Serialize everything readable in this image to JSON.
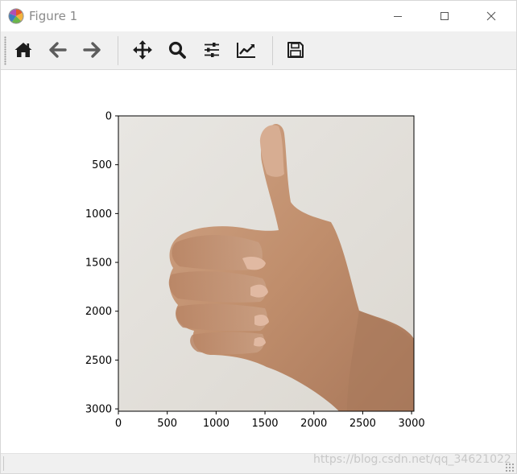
{
  "window": {
    "title": "Figure 1",
    "controls": [
      "minimize",
      "maximize",
      "close"
    ]
  },
  "toolbar": {
    "buttons": [
      {
        "name": "home",
        "icon": "home-icon",
        "tooltip": "Reset original view"
      },
      {
        "name": "back",
        "icon": "arrow-left-icon",
        "tooltip": "Back to previous view"
      },
      {
        "name": "forward",
        "icon": "arrow-right-icon",
        "tooltip": "Forward to next view"
      },
      {
        "name": "pan",
        "icon": "move-icon",
        "tooltip": "Pan axes"
      },
      {
        "name": "zoom",
        "icon": "search-icon",
        "tooltip": "Zoom to rectangle"
      },
      {
        "name": "subplots",
        "icon": "sliders-icon",
        "tooltip": "Configure subplots"
      },
      {
        "name": "customize",
        "icon": "chart-line-icon",
        "tooltip": "Edit axis"
      },
      {
        "name": "save",
        "icon": "floppy-disk-icon",
        "tooltip": "Save the figure"
      }
    ]
  },
  "plot": {
    "image_content": "thumbs-up hand photo",
    "x_ticks": [
      "0",
      "500",
      "1000",
      "1500",
      "2000",
      "2500",
      "3000"
    ],
    "y_ticks": [
      "0",
      "500",
      "1000",
      "1500",
      "2000",
      "2500",
      "3000"
    ]
  },
  "watermark": "https://blog.csdn.net/qq_34621022",
  "colors": {
    "toolbar_bg": "#f0f0f0",
    "icon": "#1c1c1c",
    "photo_bg": "#e6e3dd",
    "skin": "#c49473"
  }
}
